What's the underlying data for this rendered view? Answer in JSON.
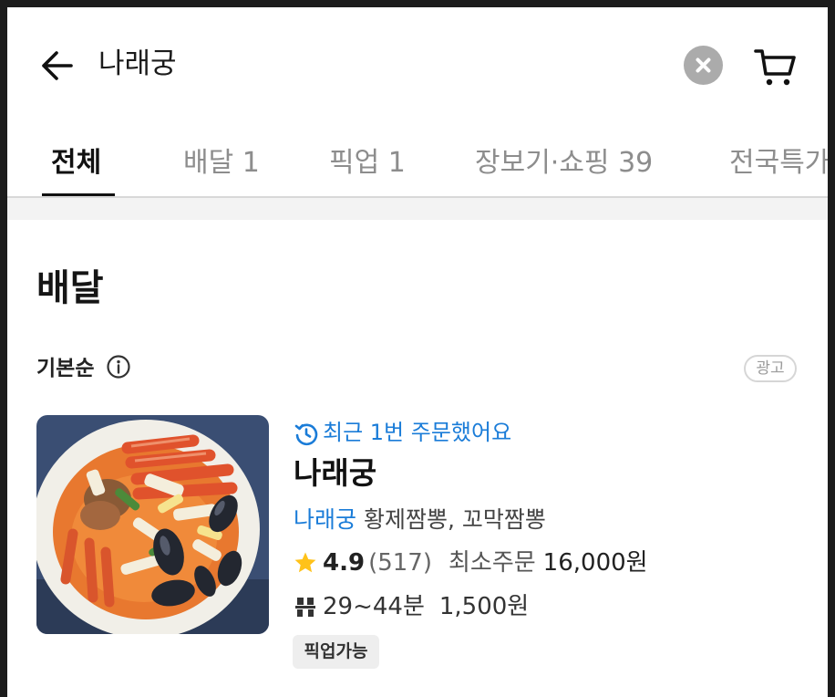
{
  "header": {
    "search_query": "나래궁",
    "icons": {
      "back": "arrow-left-icon",
      "clear": "close-circle-icon",
      "cart": "cart-icon"
    }
  },
  "tabs": [
    {
      "label": "전체",
      "active": true
    },
    {
      "label": "배달 1",
      "active": false
    },
    {
      "label": "픽업 1",
      "active": false
    },
    {
      "label": "장보기·쇼핑 39",
      "active": false
    },
    {
      "label": "전국특가",
      "active": false
    }
  ],
  "section": {
    "title": "배달",
    "sort_label": "기본순",
    "ad_badge": "광고"
  },
  "store": {
    "recent_order": "최근 1번 주문했어요",
    "name": "나래궁",
    "menu_highlight": "나래궁",
    "menu_items": " 황제짬뽕, 꼬막짬뽕",
    "rating": "4.9",
    "review_count": "(517)",
    "min_order_label": "최소주문",
    "min_order_value": "16,000원",
    "delivery_time": "29~44분",
    "delivery_fee": "1,500원",
    "tag": "픽업가능"
  },
  "colors": {
    "accent_blue": "#1a7cd8",
    "star": "#ffc21a",
    "clear_button": "#ababab",
    "active_tab": "#111111",
    "inactive_tab": "#8d8d8d"
  }
}
